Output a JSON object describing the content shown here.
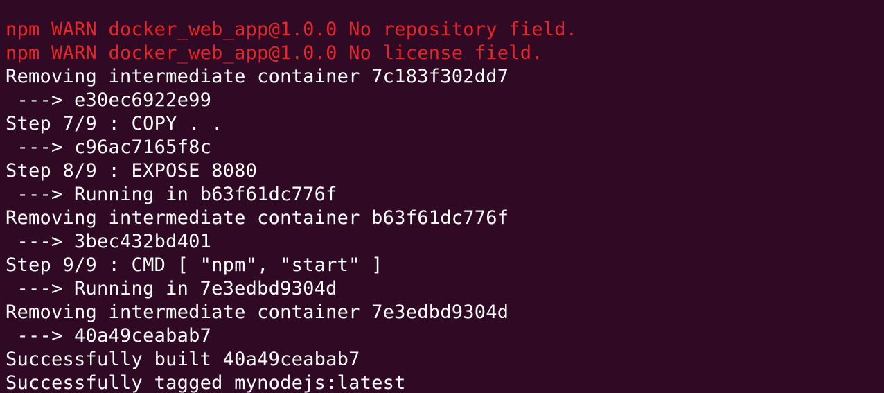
{
  "terminal": {
    "colors": {
      "background": "#300a24",
      "text": "#ffffff",
      "warning": "#e6262b"
    },
    "lines": [
      {
        "text": "npm WARN docker_web_app@1.0.0 No repository field.",
        "kind": "warn"
      },
      {
        "text": "npm WARN docker_web_app@1.0.0 No license field.",
        "kind": "warn"
      },
      {
        "text": "Removing intermediate container 7c183f302dd7",
        "kind": "normal"
      },
      {
        "text": " ---> e30ec6922e99",
        "kind": "normal"
      },
      {
        "text": "Step 7/9 : COPY . .",
        "kind": "normal"
      },
      {
        "text": " ---> c96ac7165f8c",
        "kind": "normal"
      },
      {
        "text": "Step 8/9 : EXPOSE 8080",
        "kind": "normal"
      },
      {
        "text": " ---> Running in b63f61dc776f",
        "kind": "normal"
      },
      {
        "text": "Removing intermediate container b63f61dc776f",
        "kind": "normal"
      },
      {
        "text": " ---> 3bec432bd401",
        "kind": "normal"
      },
      {
        "text": "Step 9/9 : CMD [ \"npm\", \"start\" ]",
        "kind": "normal"
      },
      {
        "text": " ---> Running in 7e3edbd9304d",
        "kind": "normal"
      },
      {
        "text": "Removing intermediate container 7e3edbd9304d",
        "kind": "normal"
      },
      {
        "text": " ---> 40a49ceabab7",
        "kind": "normal"
      },
      {
        "text": "Successfully built 40a49ceabab7",
        "kind": "normal"
      },
      {
        "text": "Successfully tagged mynodejs:latest",
        "kind": "normal"
      }
    ]
  }
}
